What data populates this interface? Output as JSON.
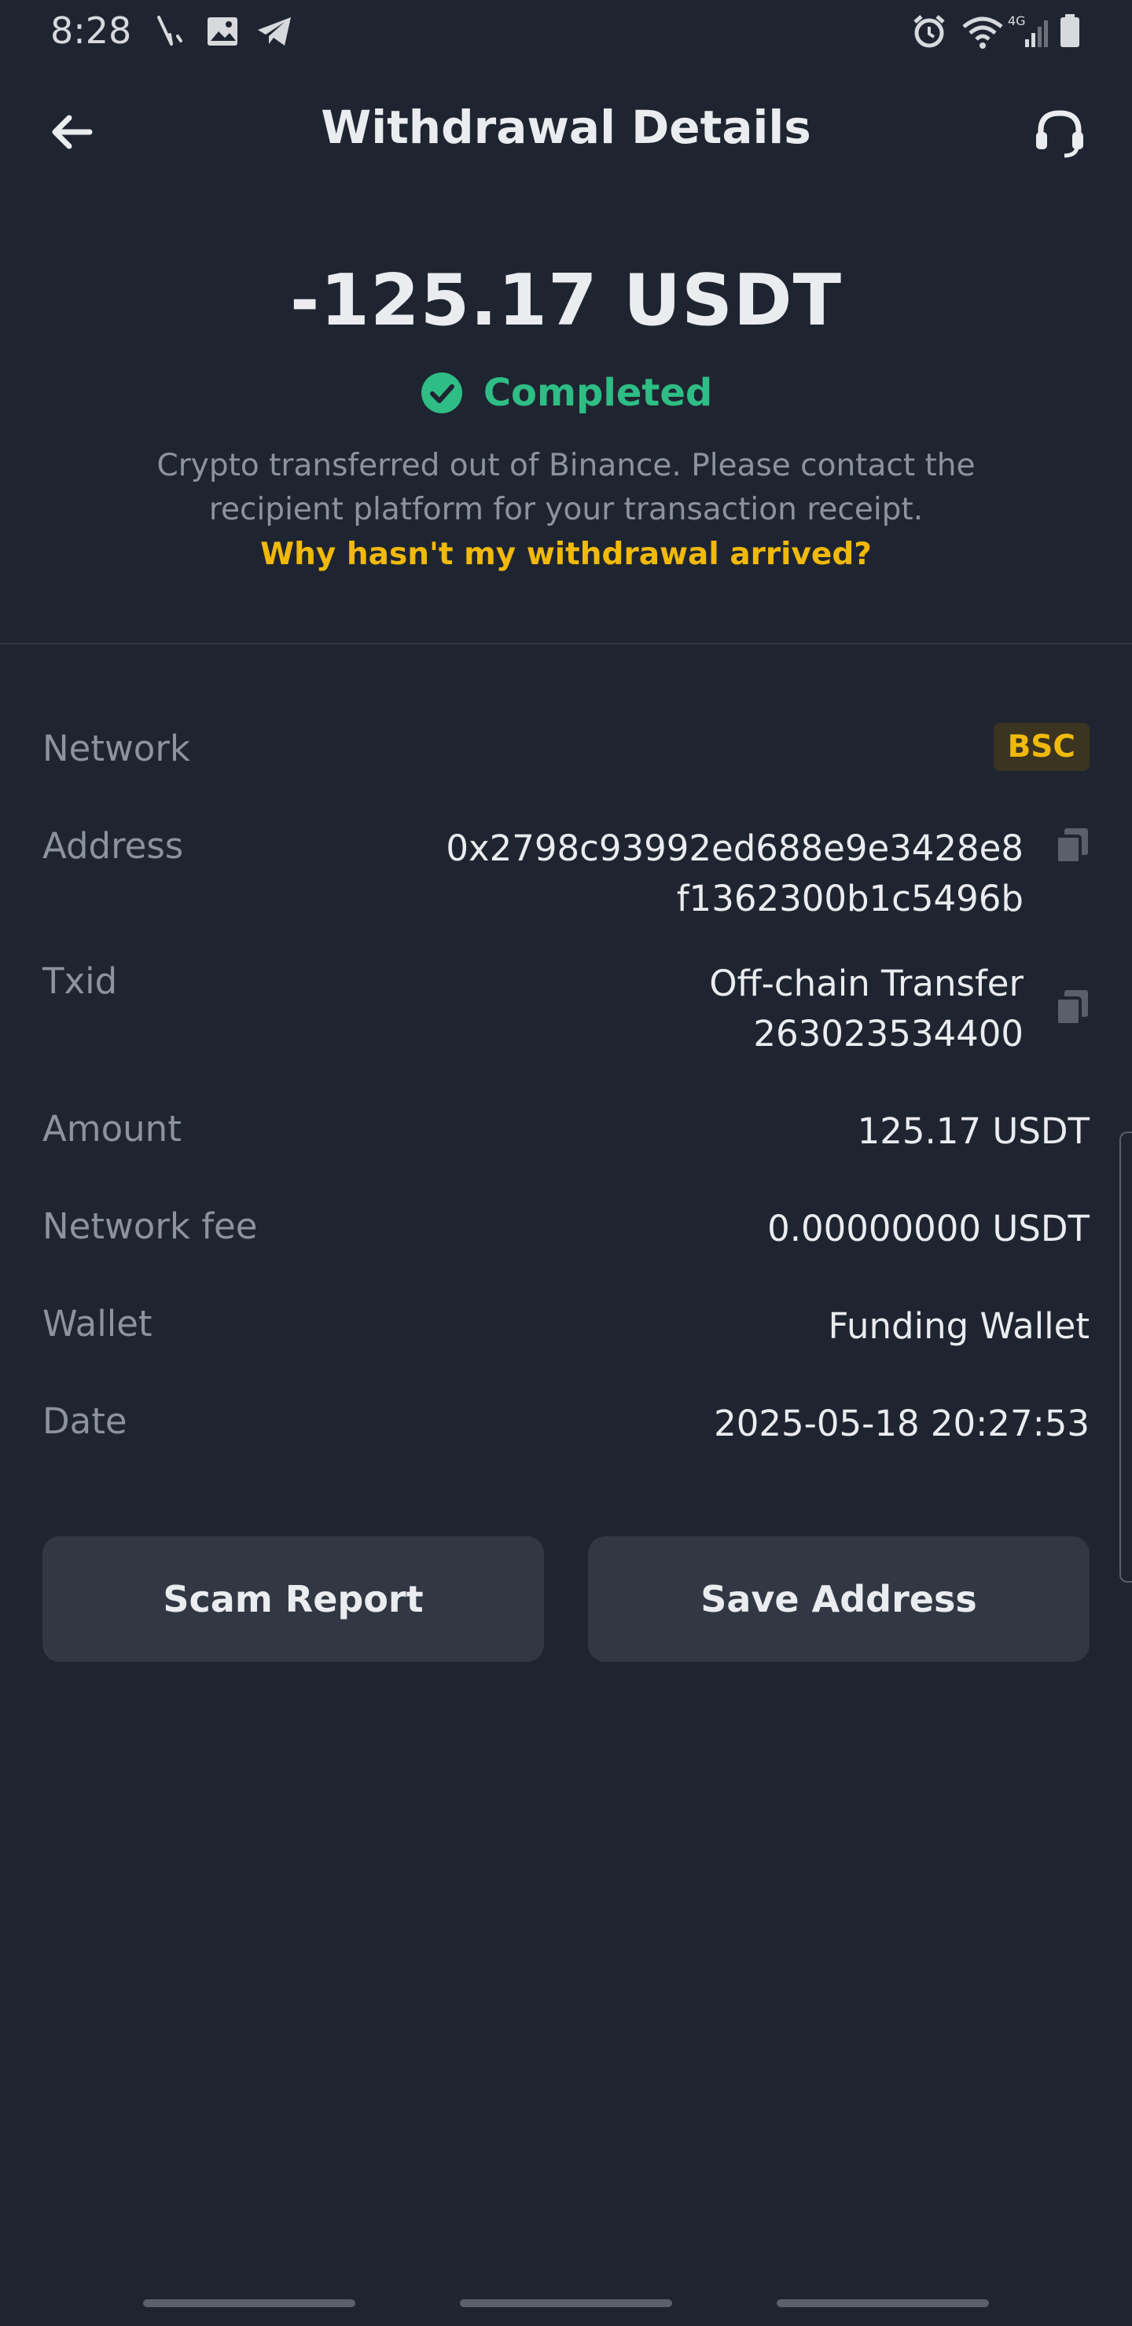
{
  "status_bar": {
    "time": "8:28"
  },
  "header": {
    "title": "Withdrawal Details"
  },
  "summary": {
    "amount": "-125.17 USDT",
    "status": "Completed",
    "description": "Crypto transferred out of Binance. Please contact the recipient platform for your transaction receipt.",
    "help_link": "Why hasn't my withdrawal arrived?"
  },
  "details": {
    "network": {
      "label": "Network",
      "value": "BSC"
    },
    "address": {
      "label": "Address",
      "line1": "0x2798c93992ed688e9e3428e8",
      "line2": "f1362300b1c5496b"
    },
    "txid": {
      "label": "Txid",
      "line1": "Off-chain Transfer",
      "line2": "263023534400"
    },
    "amount": {
      "label": "Amount",
      "value": "125.17 USDT"
    },
    "network_fee": {
      "label": "Network fee",
      "value": "0.00000000 USDT"
    },
    "wallet": {
      "label": "Wallet",
      "value": "Funding Wallet"
    },
    "date": {
      "label": "Date",
      "value": "2025-05-18 20:27:53"
    }
  },
  "actions": {
    "scam_report": "Scam Report",
    "save_address": "Save Address"
  },
  "colors": {
    "background": "#1f2530",
    "accent": "#f0b90b",
    "success": "#2ebd85",
    "muted": "#8c939d"
  },
  "icons": [
    "back-arrow-icon",
    "headset-icon",
    "check-circle-icon",
    "copy-icon"
  ]
}
